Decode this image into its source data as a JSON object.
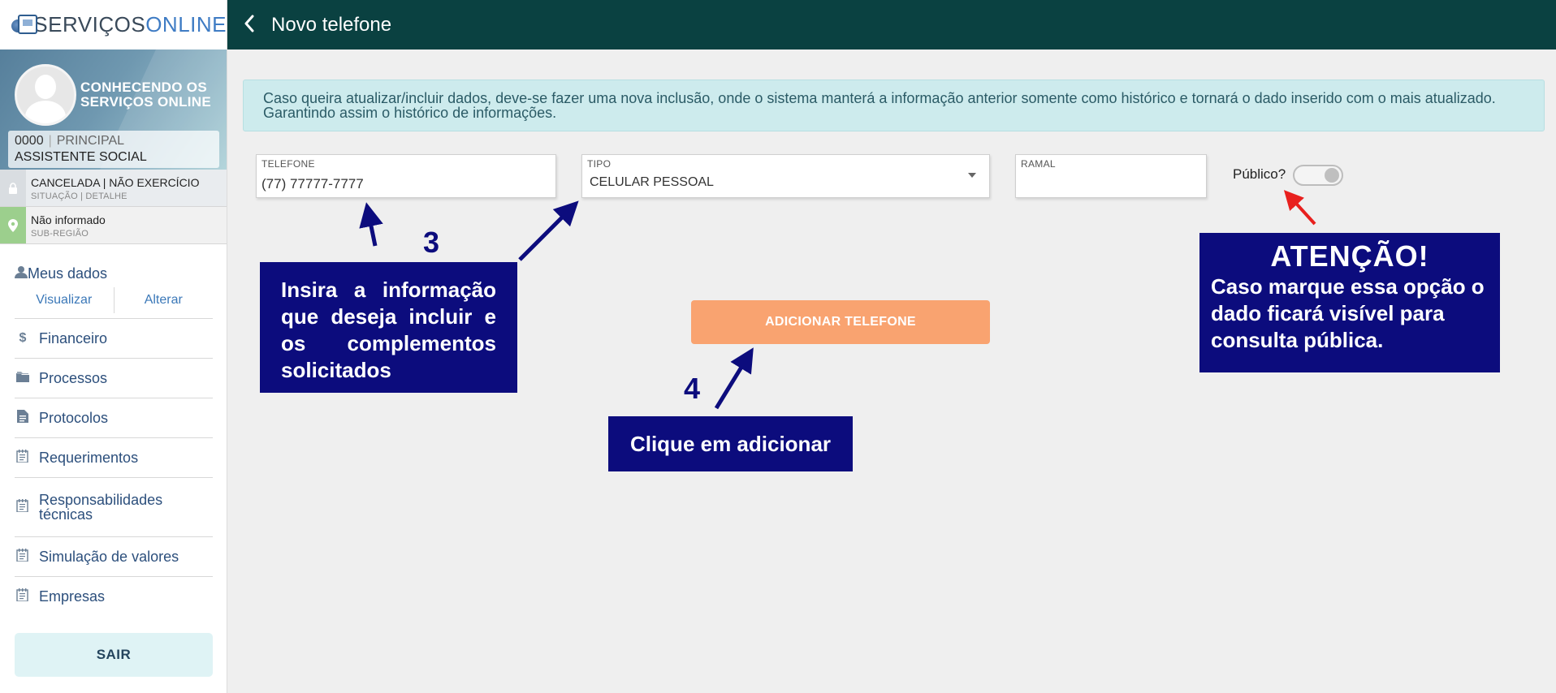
{
  "brand": {
    "part1": "SERVIÇOS",
    "part2": "ONLINE"
  },
  "profile": {
    "name": "CONHECENDO OS SERVIÇOS ONLINE",
    "registration": "0000",
    "registration_type": "PRINCIPAL",
    "profession": "ASSISTENTE SOCIAL"
  },
  "status": {
    "main": "CANCELADA | NÃO EXERCÍCIO",
    "sub": "SITUAÇÃO | DETALHE"
  },
  "region": {
    "main": "Não informado",
    "sub": "SUB-REGIÃO"
  },
  "menu": {
    "meus_dados": {
      "label": "Meus dados",
      "view": "Visualizar",
      "edit": "Alterar",
      "icon": "user-icon"
    },
    "items": [
      {
        "label": "Financeiro",
        "icon": "dollar-icon"
      },
      {
        "label": "Processos",
        "icon": "folder-icon"
      },
      {
        "label": "Protocolos",
        "icon": "document-icon"
      },
      {
        "label": "Requerimentos",
        "icon": "notepad-icon"
      },
      {
        "label": "Responsabilidades técnicas",
        "icon": "notepad-icon"
      },
      {
        "label": "Simulação de valores",
        "icon": "notepad-icon"
      },
      {
        "label": "Empresas",
        "icon": "notepad-icon"
      }
    ],
    "logout": "SAIR"
  },
  "header": {
    "title": "Novo telefone",
    "back_icon": "chevron-left-icon"
  },
  "banner": {
    "text": "Caso queira atualizar/incluir dados, deve-se fazer uma nova inclusão, onde o sistema manterá a informação anterior somente como histórico e tornará o dado inserido com o mais atualizado. Garantindo assim o histórico de informações."
  },
  "form": {
    "telefone": {
      "label": "TELEFONE",
      "value": "(77) 77777-7777"
    },
    "tipo": {
      "label": "TIPO",
      "value": "CELULAR PESSOAL"
    },
    "ramal": {
      "label": "RAMAL",
      "value": ""
    },
    "publico": {
      "label": "Público?",
      "checked": false
    },
    "submit": "ADICIONAR TELEFONE"
  },
  "annotations": {
    "step3": {
      "number": "3",
      "text": "Insira a informação que deseja incluir e os complementos solicitados"
    },
    "step4": {
      "number": "4",
      "text": "Clique em adicionar"
    },
    "attention": {
      "title": "ATENÇÃO!",
      "text": "Caso marque essa opção o dado ficará visível para consulta pública."
    }
  },
  "colors": {
    "header_bg": "#0a4141",
    "button_bg": "#f9a370",
    "banner_bg": "#cdebed",
    "callout_bg": "#0c0c7d",
    "warning_arrow": "#e8201e"
  }
}
